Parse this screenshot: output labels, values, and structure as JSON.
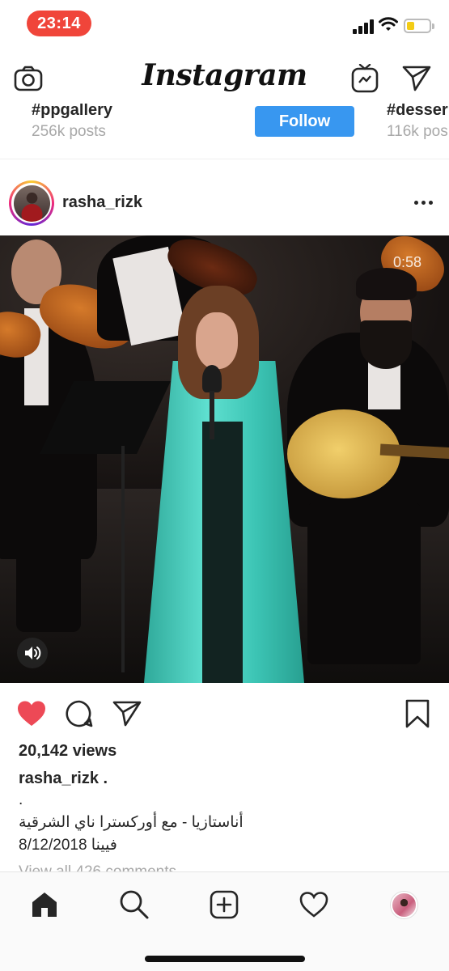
{
  "status_bar": {
    "time": "23:14",
    "battery_color": "#f3cc15",
    "time_pill_color": "#f0453a"
  },
  "header": {
    "logo": "Instagram",
    "icons": {
      "left": "camera-icon",
      "igtv": "igtv-icon",
      "direct": "send-icon"
    }
  },
  "suggestions": {
    "items": [
      {
        "tag": "#ppgallery",
        "posts": "256k posts"
      },
      {
        "tag": "#desser",
        "posts": "116k pos"
      }
    ],
    "follow_label": "Follow",
    "accent": "#3897f0"
  },
  "post": {
    "username": "rasha_rizk",
    "video_timer": "0:58",
    "views": "20,142 views",
    "caption_user": "rasha_rizk .",
    "caption_lines": [
      ".",
      "أناستازيا - مع أوركسترا ناي الشرقية",
      "فيينا 8/12/2018"
    ],
    "view_comments": "View all 426 comments",
    "liked": true,
    "like_color": "#ed4956"
  },
  "tab_bar": {
    "tabs": [
      "home-icon",
      "search-icon",
      "add-post-icon",
      "activity-heart-icon",
      "profile-avatar"
    ]
  }
}
